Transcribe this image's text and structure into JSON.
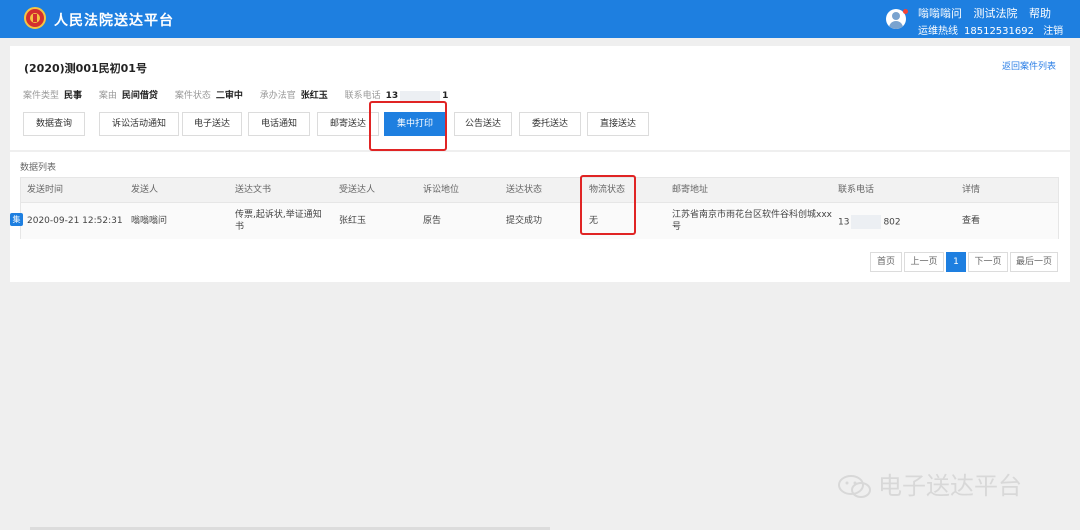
{
  "header": {
    "site_title": "人民法院送达平台",
    "user_name": "嗡嗡嗡问",
    "court_name": "测试法院",
    "help_label": "帮助",
    "hotline_label": "运维热线",
    "hotline_number": "18512531692",
    "logout_label": "注销"
  },
  "case": {
    "number": "(2020)测001民初01号",
    "back_label": "返回案件列表",
    "type_key": "案件类型",
    "type_val": "民事",
    "cause_key": "案由",
    "cause_val": "民间借贷",
    "status_key": "案件状态",
    "status_val": "二审中",
    "judge_key": "承办法官",
    "judge_val": "张红玉",
    "phone_key": "联系电话",
    "phone_start": "13",
    "phone_end": "1"
  },
  "tabs": [
    {
      "label": "数据查询"
    },
    {
      "label": "诉讼活动通知"
    },
    {
      "label": "电子送达"
    },
    {
      "label": "电话通知"
    },
    {
      "label": "邮寄送达"
    },
    {
      "label": "集中打印",
      "active": true
    },
    {
      "label": "公告送达"
    },
    {
      "label": "委托送达"
    },
    {
      "label": "直接送达"
    }
  ],
  "list": {
    "title": "数据列表",
    "columns": [
      "发送时间",
      "发送人",
      "送达文书",
      "受送达人",
      "诉讼地位",
      "送达状态",
      "物流状态",
      "邮寄地址",
      "联系电话",
      "详情"
    ],
    "rows": [
      {
        "tag": "集",
        "time": "2020-09-21 12:52:31",
        "sender": "嗡嗡嗡问",
        "docs": "传票,起诉状,举证通知书",
        "receiver": "张红玉",
        "position": "原告",
        "status": "提交成功",
        "logistics": "无",
        "address": "江苏省南京市雨花台区软件谷科创城xxx号",
        "phone_start": "13",
        "phone_end": "802",
        "detail": "查看"
      }
    ]
  },
  "pager": {
    "first": "首页",
    "prev": "上一页",
    "current": "1",
    "next": "下一页",
    "last": "最后一页"
  },
  "watermark": "电子送达平台",
  "colors": {
    "primary": "#1e7fe0",
    "highlight": "#e02424"
  }
}
